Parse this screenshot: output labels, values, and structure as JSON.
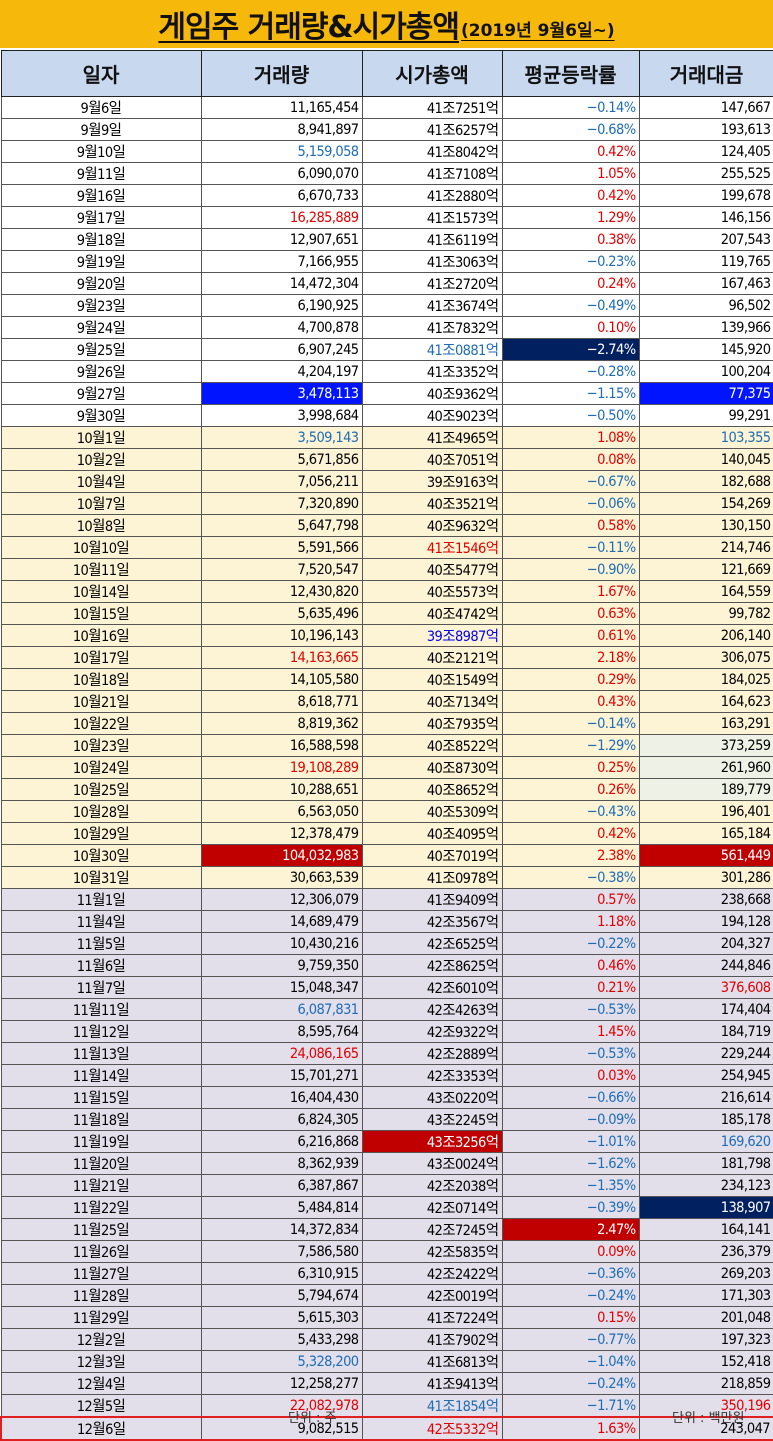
{
  "title": {
    "main": "게임주 거래량&시가총액",
    "sub": "(2019년 9월6일~)"
  },
  "headers": [
    "일자",
    "거래량",
    "시가총액",
    "평균등락률",
    "거래대금"
  ],
  "colors": {
    "title_bg": "#f6b80a",
    "header_bg": "#c7d8ef",
    "sep_bg": "#fcf4d5",
    "oct_bg": "#fcf4d5",
    "nov_bg": "#e2dfeb",
    "positive": "#e00000",
    "negative": "#1d6cb5",
    "highlight_red": "#c00000",
    "highlight_blue": "#0014ff",
    "highlight_navy": "#002060",
    "highlight_pale_green": "#eef2e6",
    "text_red": "#e00000",
    "text_blue": "#1d6cb5",
    "text_brightblue": "#0000ee"
  },
  "rows": [
    [
      "9월6일",
      "11,165,454",
      "41조7251억",
      "-0.14%",
      "147,667"
    ],
    [
      "9월9일",
      "8,941,897",
      "41조6257억",
      "-0.68%",
      "193,613"
    ],
    [
      "9월10일",
      "5,159,058",
      "41조8042억",
      "0.42%",
      "124,405"
    ],
    [
      "9월11일",
      "6,090,070",
      "41조7108억",
      "1.05%",
      "255,525"
    ],
    [
      "9월16일",
      "6,670,733",
      "41조2880억",
      "0.42%",
      "199,678"
    ],
    [
      "9월17일",
      "16,285,889",
      "41조1573억",
      "1.29%",
      "146,156"
    ],
    [
      "9월18일",
      "12,907,651",
      "41조6119억",
      "0.38%",
      "207,543"
    ],
    [
      "9월19일",
      "7,166,955",
      "41조3063억",
      "-0.23%",
      "119,765"
    ],
    [
      "9월20일",
      "14,472,304",
      "41조2720억",
      "0.24%",
      "167,463"
    ],
    [
      "9월23일",
      "6,190,925",
      "41조3674억",
      "-0.49%",
      "96,502"
    ],
    [
      "9월24일",
      "4,700,878",
      "41조7832억",
      "0.10%",
      "139,966"
    ],
    [
      "9월25일",
      "6,907,245",
      "41조0881억",
      "-2.74%",
      "145,920"
    ],
    [
      "9월26일",
      "4,204,197",
      "41조3352억",
      "-0.28%",
      "100,204"
    ],
    [
      "9월27일",
      "3,478,113",
      "40조9362억",
      "-1.15%",
      "77,375"
    ],
    [
      "9월30일",
      "3,998,684",
      "40조9023억",
      "-0.50%",
      "99,291"
    ],
    [
      "10월1일",
      "3,509,143",
      "41조4965억",
      "1.08%",
      "103,355"
    ],
    [
      "10월2일",
      "5,671,856",
      "40조7051억",
      "0.08%",
      "140,045"
    ],
    [
      "10월4일",
      "7,056,211",
      "39조9163억",
      "-0.67%",
      "182,688"
    ],
    [
      "10월7일",
      "7,320,890",
      "40조3521억",
      "-0.06%",
      "154,269"
    ],
    [
      "10월8일",
      "5,647,798",
      "40조9632억",
      "0.58%",
      "130,150"
    ],
    [
      "10월10일",
      "5,591,566",
      "41조1546억",
      "-0.11%",
      "214,746"
    ],
    [
      "10월11일",
      "7,520,547",
      "40조5477억",
      "-0.90%",
      "121,669"
    ],
    [
      "10월14일",
      "12,430,820",
      "40조5573억",
      "1.67%",
      "164,559"
    ],
    [
      "10월15일",
      "5,635,496",
      "40조4742억",
      "0.63%",
      "99,782"
    ],
    [
      "10월16일",
      "10,196,143",
      "39조8987억",
      "0.61%",
      "206,140"
    ],
    [
      "10월17일",
      "14,163,665",
      "40조2121억",
      "2.18%",
      "306,075"
    ],
    [
      "10월18일",
      "14,105,580",
      "40조1549억",
      "0.29%",
      "184,025"
    ],
    [
      "10월21일",
      "8,618,771",
      "40조7134억",
      "0.43%",
      "164,623"
    ],
    [
      "10월22일",
      "8,819,362",
      "40조7935억",
      "-0.14%",
      "163,291"
    ],
    [
      "10월23일",
      "16,588,598",
      "40조8522억",
      "-1.29%",
      "373,259"
    ],
    [
      "10월24일",
      "19,108,289",
      "40조8730억",
      "0.25%",
      "261,960"
    ],
    [
      "10월25일",
      "10,288,651",
      "40조8652억",
      "0.26%",
      "189,779"
    ],
    [
      "10월28일",
      "6,563,050",
      "40조5309억",
      "-0.43%",
      "196,401"
    ],
    [
      "10월29일",
      "12,378,479",
      "40조4095억",
      "0.42%",
      "165,184"
    ],
    [
      "10월30일",
      "104,032,983",
      "40조7019억",
      "2.38%",
      "561,449"
    ],
    [
      "10월31일",
      "30,663,539",
      "41조0978억",
      "-0.38%",
      "301,286"
    ],
    [
      "11월1일",
      "12,306,079",
      "41조9409억",
      "0.57%",
      "238,668"
    ],
    [
      "11월4일",
      "14,689,479",
      "42조3567억",
      "1.18%",
      "194,128"
    ],
    [
      "11월5일",
      "10,430,216",
      "42조6525억",
      "-0.22%",
      "204,327"
    ],
    [
      "11월6일",
      "9,759,350",
      "42조8625억",
      "0.46%",
      "244,846"
    ],
    [
      "11월7일",
      "15,048,347",
      "42조6010억",
      "0.21%",
      "376,608"
    ],
    [
      "11월11일",
      "6,087,831",
      "42조4263억",
      "-0.53%",
      "174,404"
    ],
    [
      "11월12일",
      "8,595,764",
      "42조9322억",
      "1.45%",
      "184,719"
    ],
    [
      "11월13일",
      "24,086,165",
      "42조2889억",
      "-0.53%",
      "229,244"
    ],
    [
      "11월14일",
      "15,701,271",
      "42조3353억",
      "0.03%",
      "254,945"
    ],
    [
      "11월15일",
      "16,404,430",
      "43조0220억",
      "-0.66%",
      "216,614"
    ],
    [
      "11월18일",
      "6,824,305",
      "43조2245억",
      "-0.09%",
      "185,178"
    ],
    [
      "11월19일",
      "6,216,868",
      "43조3256억",
      "-1.01%",
      "169,620"
    ],
    [
      "11월20일",
      "8,362,939",
      "43조0024억",
      "-1.62%",
      "181,798"
    ],
    [
      "11월21일",
      "6,387,867",
      "42조2038억",
      "-1.35%",
      "234,123"
    ],
    [
      "11월22일",
      "5,484,814",
      "42조0714억",
      "-0.39%",
      "138,907"
    ],
    [
      "11월25일",
      "14,372,834",
      "42조7245억",
      "2.47%",
      "164,141"
    ],
    [
      "11월26일",
      "7,586,580",
      "42조5835억",
      "0.09%",
      "236,379"
    ],
    [
      "11월27일",
      "6,310,915",
      "42조2422억",
      "-0.36%",
      "269,203"
    ],
    [
      "11월28일",
      "5,794,674",
      "42조0019억",
      "-0.24%",
      "171,303"
    ],
    [
      "11월29일",
      "5,615,303",
      "41조7224억",
      "0.15%",
      "201,048"
    ],
    [
      "12월2일",
      "5,433,298",
      "41조7902억",
      "-0.77%",
      "197,323"
    ],
    [
      "12월3일",
      "5,328,200",
      "41조6813억",
      "-1.04%",
      "152,418"
    ],
    [
      "12월4일",
      "12,258,277",
      "41조9413억",
      "-0.24%",
      "218,859"
    ],
    [
      "12월5일",
      "22,082,978",
      "41조1854억",
      "-1.71%",
      "350,196"
    ],
    [
      "12월6일",
      "9,082,515",
      "42조5332억",
      "1.63%",
      "243,047"
    ]
  ],
  "footer": {
    "left": "단위 : 주",
    "right": "단위 : 백만원"
  }
}
